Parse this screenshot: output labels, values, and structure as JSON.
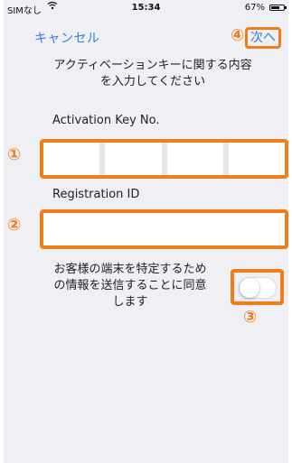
{
  "status_bar": {
    "carrier": "SIMなし",
    "wifi_icon": "wifi-icon",
    "time": "15:34",
    "battery_percent": "67%",
    "battery_level": 0.67
  },
  "nav": {
    "cancel_label": "キャンセル",
    "next_label": "次へ"
  },
  "form": {
    "instruction_line1": "アクティベーションキーに関する内容",
    "instruction_line2": "を入力してください",
    "activation_key_label": "Activation Key No.",
    "activation_key_segments": [
      "",
      "",
      "",
      ""
    ],
    "registration_id_label": "Registration ID",
    "registration_id_value": "",
    "consent_line1": "お客様の端末を特定するため",
    "consent_line2": "の情報を送信することに同意",
    "consent_line3": "します",
    "consent_enabled": false
  },
  "annotations": {
    "marker_1": "①",
    "marker_2": "②",
    "marker_3": "③",
    "marker_4": "④",
    "highlight_color": "#f07d1a"
  }
}
